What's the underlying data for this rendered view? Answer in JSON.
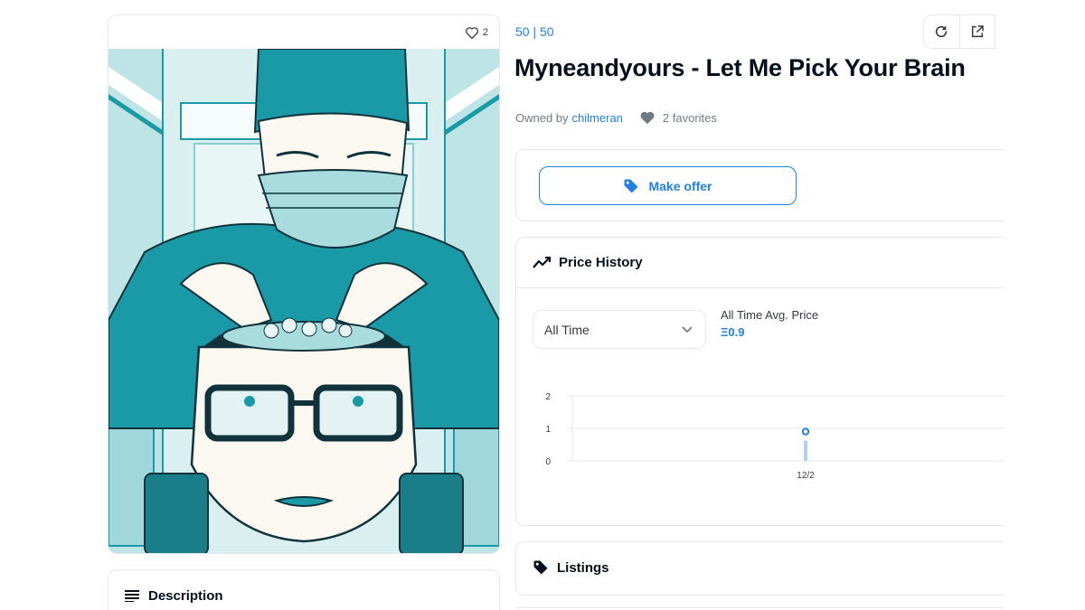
{
  "asset": {
    "favorite_count": "2",
    "collection": "50 | 50",
    "title": "Myneandyours - Let Me Pick Your Brain",
    "owned_by_label": "Owned by",
    "owner": "chilmeran",
    "favorites_text": "2 favorites"
  },
  "actions": {
    "make_offer": "Make offer"
  },
  "price_history": {
    "title": "Price History",
    "range_selected": "All Time",
    "avg_label": "All Time Avg. Price",
    "avg_value": "Ξ0.9"
  },
  "chart_data": {
    "type": "scatter",
    "title": "",
    "xlabel": "",
    "ylabel": "",
    "x": [
      "12/2"
    ],
    "y": [
      0.9
    ],
    "ylim": [
      0,
      2
    ],
    "y_ticks": [
      "0",
      "1",
      "2"
    ],
    "grid": true,
    "marker_color": "#2081e2"
  },
  "listings": {
    "title": "Listings"
  },
  "description": {
    "title": "Description"
  },
  "colors": {
    "accent": "#2081e2",
    "border": "#e5e8eb",
    "teal": "#1a9aa6",
    "light_teal": "#a9dcdf"
  }
}
